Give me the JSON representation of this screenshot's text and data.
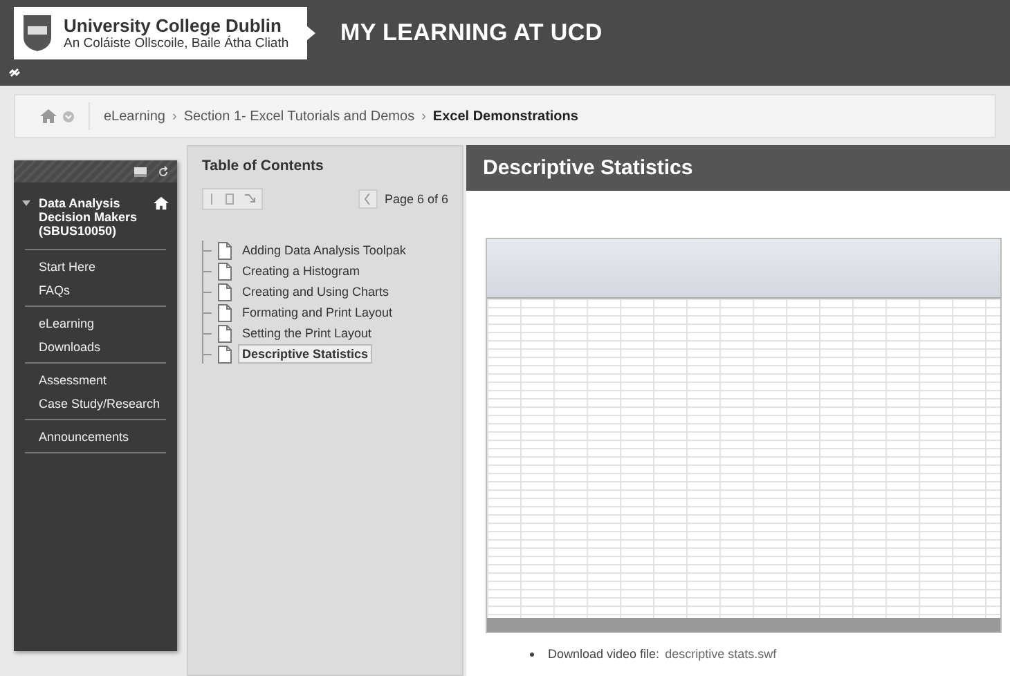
{
  "header": {
    "university": "University College Dublin",
    "university_irish": "An Coláiste Ollscoile, Baile Átha Cliath",
    "site_title": "MY LEARNING AT UCD"
  },
  "breadcrumb_separator": "›",
  "breadcrumb": [
    {
      "label": "eLearning",
      "current": false
    },
    {
      "label": "Section 1- Excel Tutorials and Demos",
      "current": false
    },
    {
      "label": "Excel Demonstrations",
      "current": true
    }
  ],
  "sidebar": {
    "course": "Data Analysis Decision Makers (SBUS10050)",
    "groups": [
      [
        "Start Here",
        "FAQs"
      ],
      [
        "eLearning",
        "Downloads"
      ],
      [
        "Assessment",
        "Case Study/Research"
      ],
      [
        "Announcements"
      ]
    ]
  },
  "toc": {
    "title": "Table of Contents",
    "page": "Page 6 of 6",
    "items": [
      {
        "label": "Adding Data Analysis Toolpak",
        "selected": false
      },
      {
        "label": "Creating a Histogram",
        "selected": false
      },
      {
        "label": "Creating and Using Charts",
        "selected": false
      },
      {
        "label": "Formating and Print Layout",
        "selected": false
      },
      {
        "label": "Setting the Print Layout",
        "selected": false
      },
      {
        "label": "Descriptive Statistics",
        "selected": true
      }
    ]
  },
  "content": {
    "title": "Descriptive Statistics",
    "download_label": "Download video file:",
    "download_link": "descriptive stats.swf"
  }
}
